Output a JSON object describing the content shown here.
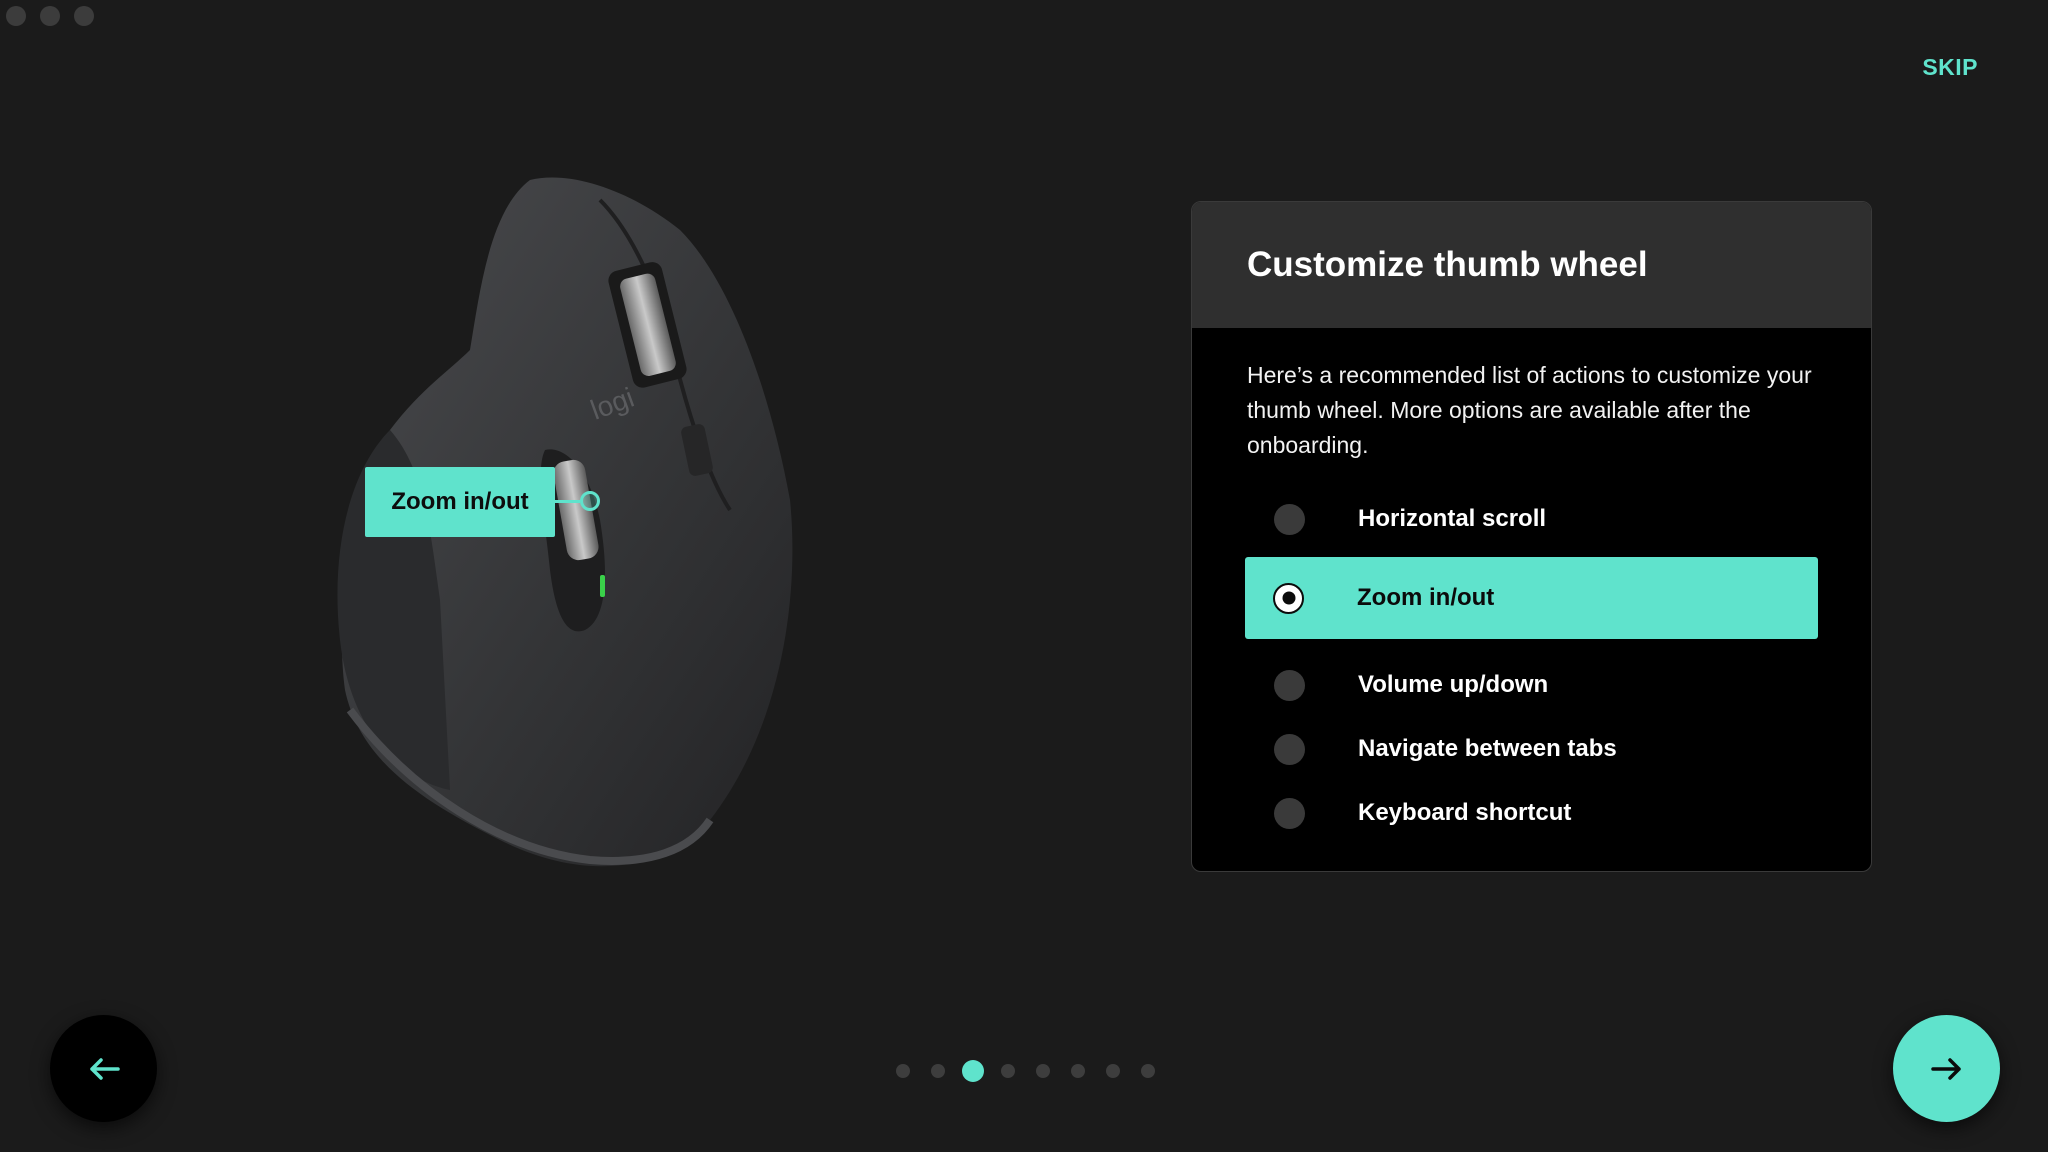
{
  "window": {
    "controls": [
      "close",
      "minimize",
      "maximize"
    ]
  },
  "header": {
    "skip_label": "SKIP"
  },
  "illustration": {
    "callout_label": "Zoom in/out",
    "device_logo_text": "logi"
  },
  "card": {
    "title": "Customize thumb wheel",
    "description": "Here’s a recommended list of actions to customize your thumb wheel. More options are available after the onboarding.",
    "options": [
      {
        "label": "Horizontal scroll",
        "selected": false
      },
      {
        "label": "Zoom in/out",
        "selected": true
      },
      {
        "label": "Volume up/down",
        "selected": false
      },
      {
        "label": "Navigate between tabs",
        "selected": false
      },
      {
        "label": "Keyboard shortcut",
        "selected": false
      }
    ]
  },
  "navigation": {
    "back_icon": "arrow-left-icon",
    "next_icon": "arrow-right-icon",
    "page_count": 8,
    "current_page": 3
  },
  "colors": {
    "accent": "#5fe3cc",
    "background": "#1b1b1b",
    "card_header": "#2f2f2f",
    "card_body": "#000000"
  }
}
